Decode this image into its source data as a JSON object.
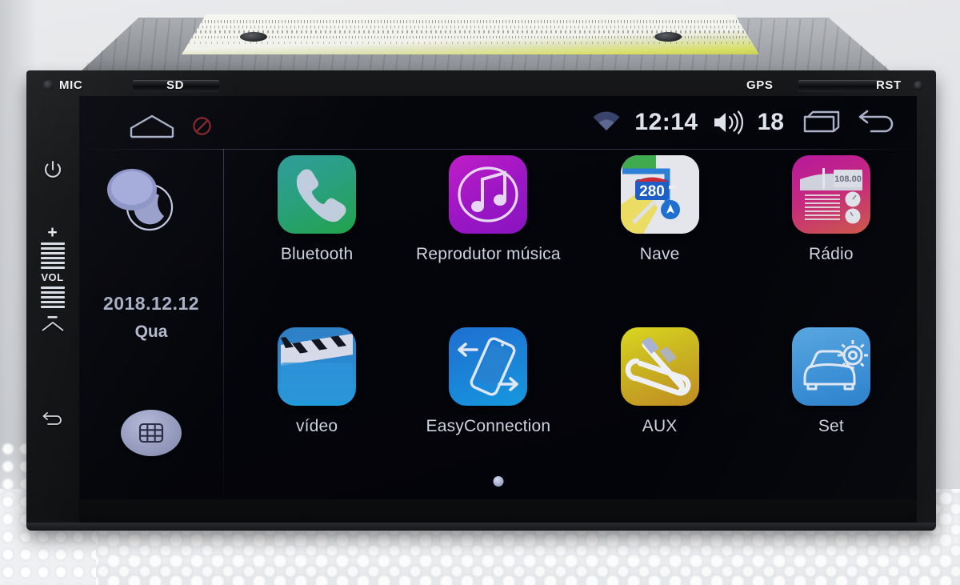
{
  "device": {
    "bezel_labels": {
      "mic": "MIC",
      "sd": "SD",
      "gps": "GPS",
      "rst": "RST"
    },
    "hardware_buttons": {
      "power": "power-button",
      "volume_up": "+",
      "volume_label": "VOL",
      "volume_down": "–",
      "home": "home-button",
      "back": "back-button"
    }
  },
  "statusbar": {
    "home_icon": "home-icon",
    "no_entry_icon": "no-entry-icon",
    "wifi_icon": "wifi-icon",
    "clock": "12:14",
    "volume_icon": "volume-icon",
    "volume_level": "18",
    "recents_icon": "recents-icon",
    "back_icon": "back-arrow-icon"
  },
  "sidebar": {
    "weather_icon": "cloud-moon-icon",
    "date": "2018.12.12",
    "weekday": "Qua",
    "apps_button": "apps-grid-icon"
  },
  "home": {
    "page_indicator_dots": 1,
    "apps": [
      {
        "label": "Bluetooth",
        "icon": "phone-handset-icon",
        "icon_class": "ic-bt"
      },
      {
        "label": "Reprodutor música",
        "icon": "music-note-icon",
        "icon_class": "ic-music"
      },
      {
        "label": "Nave",
        "icon": "map-icon",
        "icon_class": "ic-nave",
        "badge": "280"
      },
      {
        "label": "Rádio",
        "icon": "radio-icon",
        "icon_class": "ic-radio",
        "display": "108.00"
      },
      {
        "label": "vídeo",
        "icon": "clapperboard-icon",
        "icon_class": "ic-video"
      },
      {
        "label": "EasyConnection",
        "icon": "phone-mirror-icon",
        "icon_class": "ic-easy"
      },
      {
        "label": "AUX",
        "icon": "aux-cable-icon",
        "icon_class": "ic-aux"
      },
      {
        "label": "Set",
        "icon": "car-gear-icon",
        "icon_class": "ic-set"
      }
    ]
  },
  "colors": {
    "screen_bg": "#04050a",
    "status_text": "#dfe3ec",
    "app_label": "#ced3e2",
    "date_text": "#a9afc4",
    "bezel_label": "#f2f3f5",
    "no_entry": "#8c2a32"
  }
}
